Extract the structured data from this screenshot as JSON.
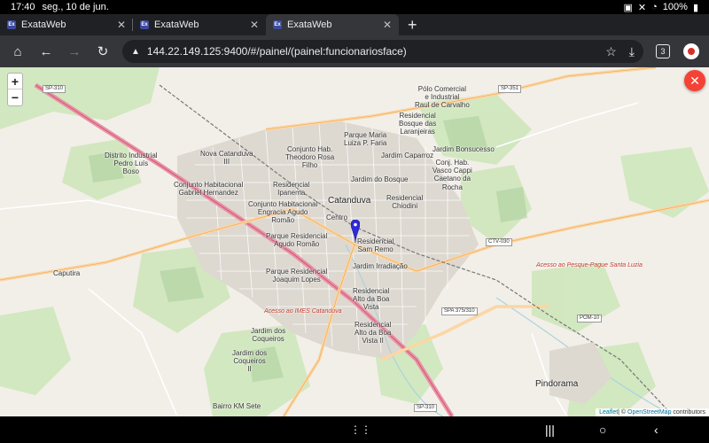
{
  "status": {
    "time": "17:40",
    "date": "seg., 10 de jun.",
    "battery": "100%"
  },
  "tabs": [
    {
      "title": "ExataWeb",
      "favicon": "Ex"
    },
    {
      "title": "ExataWeb",
      "favicon": "Ex"
    },
    {
      "title": "ExataWeb",
      "favicon": "Ex"
    }
  ],
  "toolbar": {
    "url": "144.22.149.125:9400/#/painel/(painel:funcionariosface)",
    "tab_count": "3"
  },
  "map": {
    "zoom_in": "+",
    "zoom_out": "−",
    "close_icon": "✕",
    "attribution_leaflet": "Leaflet",
    "attribution_rest": "| © ",
    "attribution_osm": "OpenStreetMap",
    "attribution_contrib": " contributors",
    "labels": {
      "catanduva": "Catanduva",
      "centro": "Centro",
      "polo": "Pólo Comercial\ne Industrial\nRaul de Carvalho",
      "bosque_laranjeiras": "Residencial\nBosque das\nLaranjeiras",
      "parque_maria": "Parque Maria\nLuiza P. Faria",
      "conj_theodoro": "Conjunto Hab.\nTheodoro Rosa\nFilho",
      "jardim_caparroz": "Jardim Caparroz",
      "jardim_bonsucesso": "Jardim Bonsucesso",
      "nova_catanduva": "Nova Catanduva\nIII",
      "distrito": "Distrito Industrial\nPedro Luís\nBoso",
      "conj_gabriel": "Conjunto Habitacional\nGabriel Hernandez",
      "res_ipanema": "Residencial\nIpanema",
      "jardim_bosque": "Jardim do Bosque",
      "conj_vasco": "Conj. Hab.\nVasco Cappi\nCaetano da\nRocha",
      "res_chiodini": "Residencial\nChiodini",
      "conj_enqracia": "Conjunto Habitacional\nEngracia Agudo\nRomão",
      "parque_agudo": "Parque Residencial\nAgudo Romão",
      "res_sam_remo": "Residencial\nSam Remo",
      "jardim_irradiacao": "Jardim Irradiação",
      "parque_joaquim": "Parque Residencial\nJoaquim Lopes",
      "res_alto_vista": "Residencial\nAlto da Boa\nVista",
      "res_alto_vista2": "Residencial\nAlto da Boa\nVista II",
      "jardim_coqueiros": "Jardim dos\nCoqueiros",
      "jardim_coqueiros2": "Jardim dos\nCoqueiros\nII",
      "caputira": "Caputira",
      "pindorama": "Pindorama",
      "bairro_km": "Bairro KM Sete",
      "acesso_imes": "Acesso ao IMES Catanduva",
      "acesso_pesque": "Acesso ao Pesque-Pague Santa Luzia"
    },
    "roads": {
      "sp310_a": "SP-310",
      "sp310_b": "SP-310",
      "sp351": "SP-351",
      "ctv030": "CTV-030",
      "spa375": "SPA 375/310",
      "pom10": "POM-10"
    }
  }
}
